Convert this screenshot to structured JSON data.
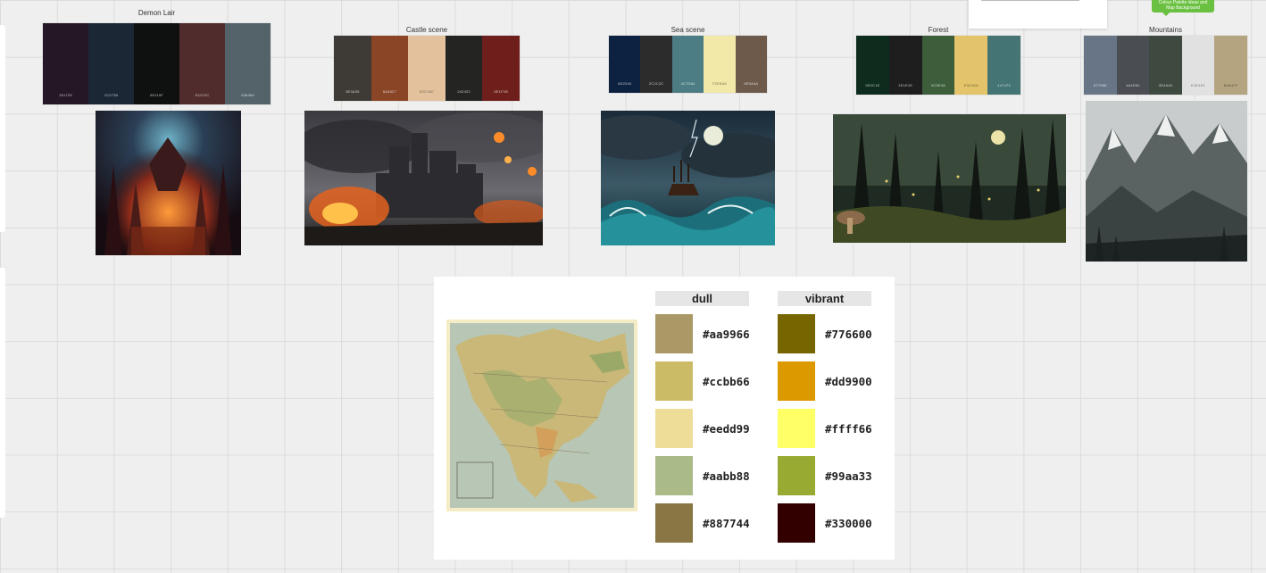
{
  "boards": [
    {
      "title": "Demon Lair",
      "swatches": [
        {
          "color": "#251725",
          "hex": "251725"
        },
        {
          "color": "#1C2735",
          "hex": "1C2735"
        },
        {
          "color": "#0E110F",
          "hex": "0E110F"
        },
        {
          "color": "#512C2C",
          "hex": "512C2C"
        },
        {
          "color": "#536369",
          "hex": "536369"
        }
      ]
    },
    {
      "title": "Castle scene",
      "swatches": [
        {
          "color": "#3e3a35",
          "hex": "3E3A35"
        },
        {
          "color": "#8a4527",
          "hex": "8A4527"
        },
        {
          "color": "#e2c19c",
          "hex": "E2C19C"
        },
        {
          "color": "#242422",
          "hex": "242422"
        },
        {
          "color": "#6e1f1b",
          "hex": "6E1F1B"
        }
      ]
    },
    {
      "title": "Sea scene",
      "swatches": [
        {
          "color": "#0d2240",
          "hex": "0D2240"
        },
        {
          "color": "#2c2c2c",
          "hex": "2C2C2C"
        },
        {
          "color": "#4c7d84",
          "hex": "4C7D84"
        },
        {
          "color": "#f2e8a8",
          "hex": "F2E8A8"
        },
        {
          "color": "#6e5a4a",
          "hex": "6E5A4A"
        }
      ]
    },
    {
      "title": "Forest",
      "swatches": [
        {
          "color": "#0e2c1e",
          "hex": "0E2C1E"
        },
        {
          "color": "#1e1e1e",
          "hex": "1E1E1E"
        },
        {
          "color": "#3c5e3a",
          "hex": "3C5E3A"
        },
        {
          "color": "#e3c46a",
          "hex": "E3C46A"
        },
        {
          "color": "#447473",
          "hex": "447473"
        }
      ]
    },
    {
      "title": "Mountains",
      "swatches": [
        {
          "color": "#677586",
          "hex": "677586"
        },
        {
          "color": "#4a4d52",
          "hex": "4A4D52"
        },
        {
          "color": "#3e4a40",
          "hex": "3E4A40"
        },
        {
          "color": "#e1e1e1",
          "hex": "E1E1E1"
        },
        {
          "color": "#b4a47f",
          "hex": "B4A47F"
        }
      ]
    }
  ],
  "sticky_note": "Colour Palette ideas and Map Background",
  "map_panel": {
    "dull_label": "dull",
    "vibrant_label": "vibrant",
    "dull": [
      {
        "color": "#aa9966",
        "label": "#aa9966"
      },
      {
        "color": "#ccbb66",
        "label": "#ccbb66"
      },
      {
        "color": "#eedd99",
        "label": "#eedd99"
      },
      {
        "color": "#aabb88",
        "label": "#aabb88"
      },
      {
        "color": "#887744",
        "label": "#887744"
      }
    ],
    "vibrant": [
      {
        "color": "#776600",
        "label": "#776600"
      },
      {
        "color": "#dd9900",
        "label": "#dd9900"
      },
      {
        "color": "#ffff66",
        "label": "#ffff66"
      },
      {
        "color": "#99aa33",
        "label": "#99aa33"
      },
      {
        "color": "#330000",
        "label": "#330000"
      }
    ]
  }
}
